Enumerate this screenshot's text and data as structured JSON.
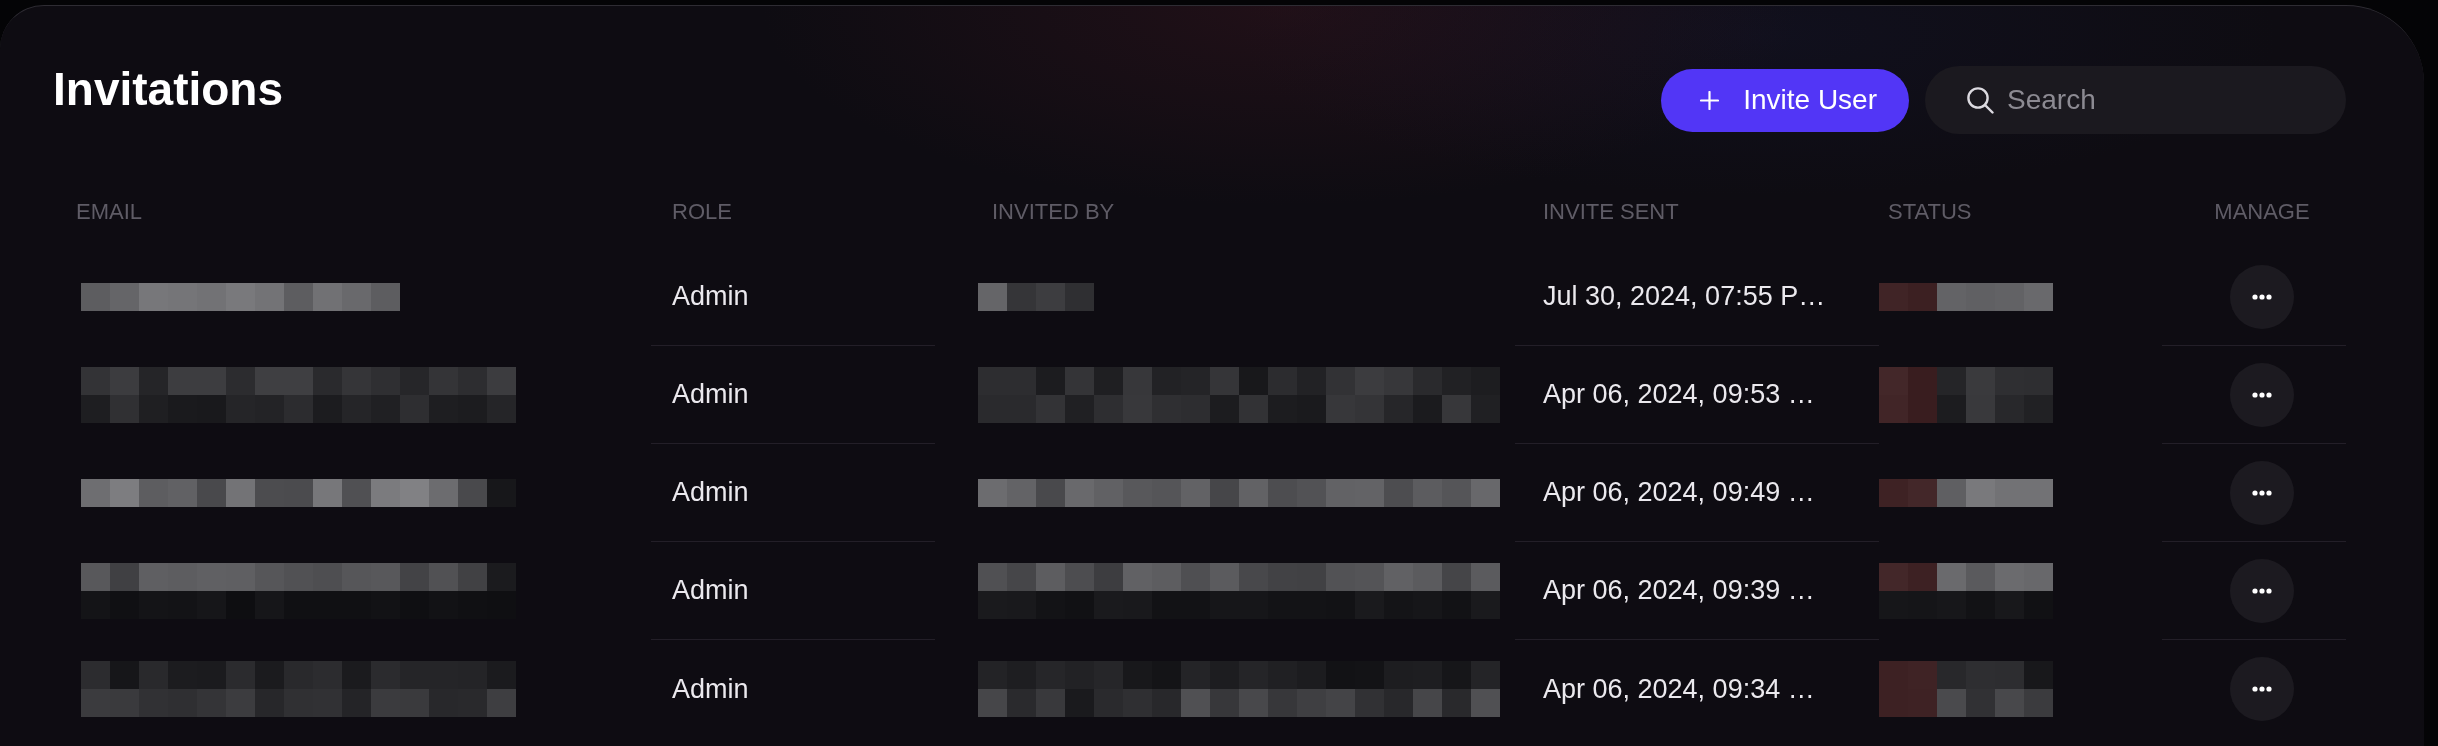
{
  "page": {
    "title": "Invitations"
  },
  "actions": {
    "invite_button": {
      "label": "Invite User"
    },
    "search": {
      "placeholder": "Search"
    }
  },
  "table": {
    "columns": [
      "EMAIL",
      "ROLE",
      "INVITED BY",
      "INVITE SENT",
      "STATUS",
      "MANAGE"
    ],
    "rows": [
      {
        "role": "Admin",
        "invite_sent": "Jul 30, 2024, 07:55 P…"
      },
      {
        "role": "Admin",
        "invite_sent": "Apr 06, 2024, 09:53 …"
      },
      {
        "role": "Admin",
        "invite_sent": "Apr 06, 2024, 09:49 …"
      },
      {
        "role": "Admin",
        "invite_sent": "Apr 06, 2024, 09:39 …"
      },
      {
        "role": "Admin",
        "invite_sent": "Apr 06, 2024, 09:34 …"
      }
    ]
  }
}
